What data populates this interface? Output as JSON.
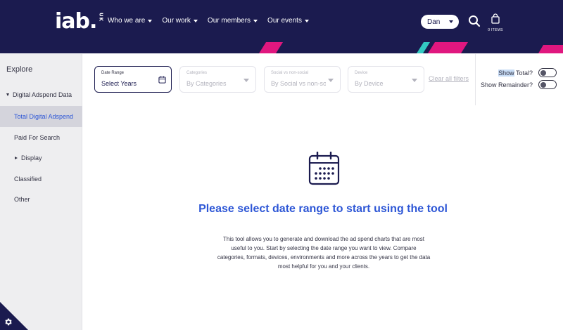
{
  "header": {
    "logo": "iab.",
    "logo_suffix": "UK",
    "nav": [
      "Who we are",
      "Our work",
      "Our members",
      "Our events"
    ],
    "user": "Dan",
    "cart_label": "0 ITEMS",
    "colors": {
      "navy": "#1b1b4f",
      "pink": "#e0177f",
      "teal": "#33c9c2"
    }
  },
  "sidebar": {
    "title": "Explore",
    "items": [
      {
        "label": "Digital Adspend Data",
        "icon": "triangle-down",
        "active": false
      },
      {
        "label": "Total Digital Adspend",
        "icon": "",
        "active": true
      },
      {
        "label": "Paid For Search",
        "icon": "",
        "active": false
      },
      {
        "label": "Display",
        "icon": "triangle-right",
        "active": false
      },
      {
        "label": "Classified",
        "icon": "",
        "active": false
      },
      {
        "label": "Other",
        "icon": "",
        "active": false
      }
    ]
  },
  "filters": [
    {
      "label": "Date Range",
      "value": "Select Years",
      "icon": "calendar-icon",
      "active": true
    },
    {
      "label": "Categories",
      "value": "By Categories",
      "icon": "caret-icon",
      "active": false
    },
    {
      "label": "Social vs non-social",
      "value": "By Social vs non-so",
      "icon": "caret-icon",
      "active": false
    },
    {
      "label": "Device",
      "value": "By Device",
      "icon": "caret-icon",
      "active": false
    }
  ],
  "clear_filters": "Clear all filters",
  "toggles": {
    "show_total": {
      "label_highlight": "Show",
      "label_rest": " Total?",
      "on": false
    },
    "show_remainder": {
      "label": "Show Remainder?",
      "on": false
    }
  },
  "main": {
    "heading": "Please select date range to start using the tool",
    "description": "This tool allows you to generate and download the ad spend charts that are most useful to you. Start by selecting the date range you want to view. Compare categories, formats, devices, environments and more across the years to get the data most helpful for you and your clients."
  }
}
